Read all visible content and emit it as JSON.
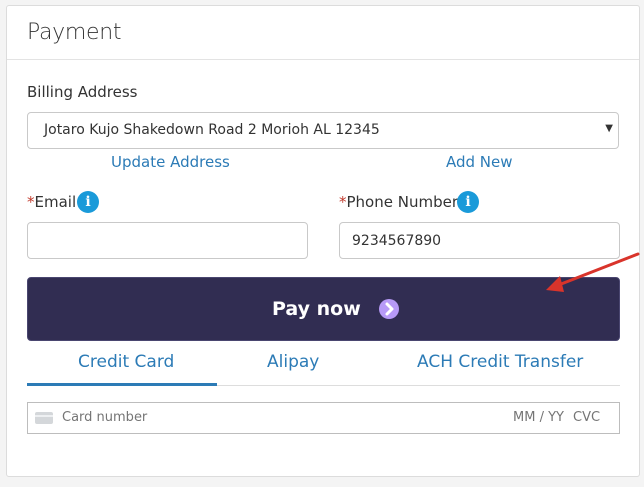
{
  "panel": {
    "title": "Payment"
  },
  "billing": {
    "label": "Billing Address",
    "selected_address": "Jotaro Kujo Shakedown Road 2 Morioh AL 12345",
    "update_link": "Update Address",
    "add_link": "Add New"
  },
  "email": {
    "required_mark": "*",
    "label": "Email",
    "value": "",
    "info_glyph": "i"
  },
  "phone": {
    "required_mark": "*",
    "label": "Phone Number",
    "value": "9234567890",
    "info_glyph": "i"
  },
  "pay_button": {
    "label": "Pay now",
    "icon": "chevron-right-icon",
    "color": "#312d52"
  },
  "tabs": [
    {
      "label": "Credit Card",
      "active": true
    },
    {
      "label": "Alipay",
      "active": false
    },
    {
      "label": "ACH Credit Transfer",
      "active": false
    }
  ],
  "card": {
    "placeholder": "Card number",
    "expiry_placeholder": "MM / YY",
    "cvc_placeholder": "CVC"
  },
  "colors": {
    "accent": "#2c7bb6",
    "info": "#1a9ad9",
    "annotation_arrow": "#d9342b"
  }
}
